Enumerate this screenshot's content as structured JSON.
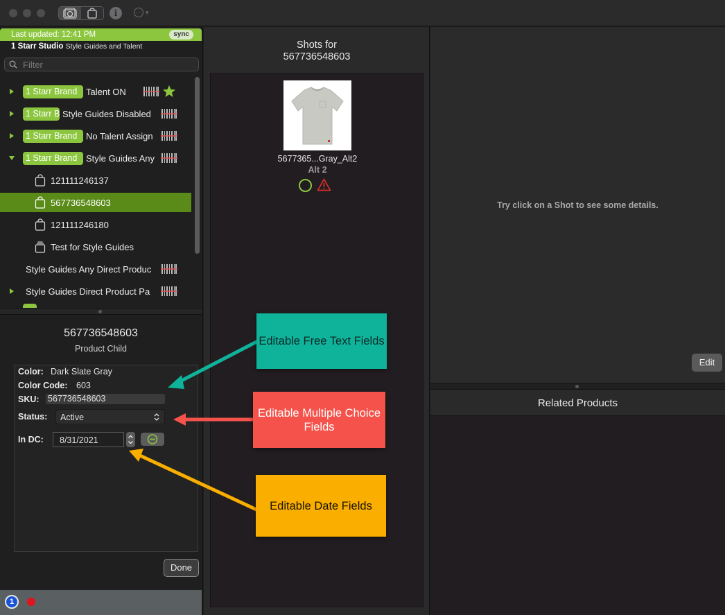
{
  "toolbar": {
    "traffic_lights": [
      "close",
      "minimize",
      "zoom"
    ],
    "icons": [
      "camera-icon",
      "bag-icon",
      "info-icon",
      "more-icon"
    ]
  },
  "sidebar": {
    "last_updated": "Last updated: 12:41 PM",
    "sync_label": "sync",
    "studio_name": "1 Starr Studio",
    "studio_sub": "Style Guides and Talent",
    "filter_placeholder": "Filter",
    "tree": [
      {
        "pill": "1 Starr Brand",
        "label": "Talent ON",
        "expanded": false
      },
      {
        "pill": "1 Starr B",
        "label": "Style Guides Disabled",
        "expanded": false
      },
      {
        "pill": "1 Starr Brand",
        "label": "No Talent Assign",
        "expanded": false
      },
      {
        "pill": "1 Starr Brand",
        "label": "Style Guides Any",
        "expanded": true
      },
      {
        "label": "121111246137"
      },
      {
        "label": "567736548603",
        "selected": true
      },
      {
        "label": "121111246180"
      },
      {
        "label": "Test for Style Guides"
      },
      {
        "label": "Style Guides Any Direct Produc"
      },
      {
        "label": "Style Guides Direct Product Pa"
      }
    ]
  },
  "detail": {
    "title": "567736548603",
    "subtitle": "Product Child",
    "color_label": "Color:",
    "color_value": "Dark Slate Gray",
    "color_code_label": "Color Code:",
    "color_code_value": "603",
    "sku_label": "SKU:",
    "sku_value": "567736548603",
    "status_label": "Status:",
    "status_value": "Active",
    "in_dc_label": "In DC:",
    "in_dc_value": "8/31/2021",
    "done_label": "Done"
  },
  "bottom_bar": {
    "onepassword_glyph": "1"
  },
  "shots": {
    "title_line1": "Shots for",
    "title_line2": "567736548603",
    "items": [
      {
        "name": "5677365...Gray_Alt2",
        "alt": "Alt 2"
      }
    ]
  },
  "right": {
    "hint": "Try click on a Shot to see some details.",
    "edit_label": "Edit",
    "related_title": "Related Products"
  },
  "annotations": {
    "free_text": "Editable Free Text Fields",
    "multiple_choice": "Editable Multiple Choice Fields",
    "date": "Editable Date Fields",
    "colors": {
      "free_text": "#0fb39a",
      "multiple_choice": "#f4524a",
      "date": "#f9ae00"
    }
  },
  "colors": {
    "accent_green": "#8cc63f",
    "selection_green": "#5a8b18",
    "barcode_red": "#e05050"
  }
}
